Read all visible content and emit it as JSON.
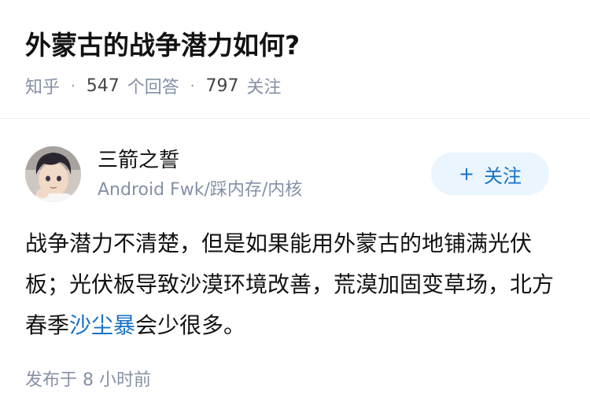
{
  "question": {
    "title": "外蒙古的战争潜力如何?"
  },
  "meta": {
    "source": "知乎",
    "answers_count": "547",
    "answers_label": "个回答",
    "followers_count": "797",
    "followers_label": "关注"
  },
  "author": {
    "name": "三箭之誓",
    "bio": "Android Fwk/踩内存/内核",
    "follow_label": "关注",
    "follow_icon": "plus-icon"
  },
  "answer": {
    "text_before": "战争潜力不清楚，但是如果能用外蒙古的地铺满光伏板；光伏板导致沙漠环境改善，荒漠加固变草场，北方春季",
    "link_text": "沙尘暴",
    "text_after": "会少很多。"
  },
  "footer": {
    "published_prefix": "发布于",
    "published_time": "8 小时前"
  },
  "colors": {
    "link": "#1772c6",
    "muted": "#8590a6",
    "follow_bg": "#ebf5fd"
  }
}
